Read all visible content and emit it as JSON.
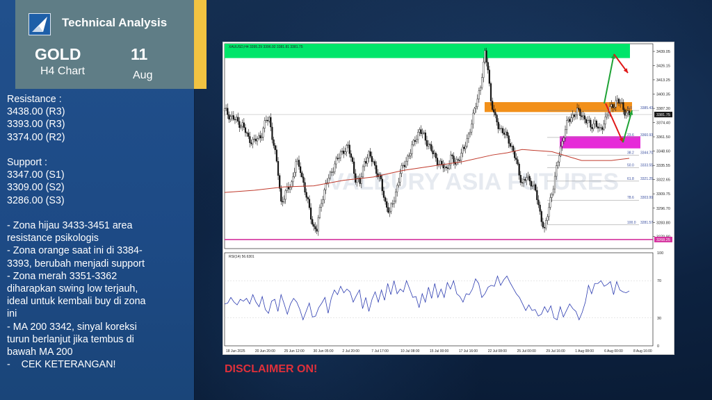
{
  "header": {
    "title": "Technical Analysis",
    "instrument": "GOLD",
    "timeframe": "H4 Chart",
    "day": "11",
    "month": "Aug"
  },
  "notes": [
    "Resistance :",
    "3438.00 (R3)",
    "3393.00 (R3)",
    "3374.00 (R2)",
    "",
    "Support :",
    "3347.00 (S1)",
    "3309.00 (S2)",
    "3286.00 (S3)",
    "",
    "- Zona hijau 3433-3451 area",
    "resistance psikologis",
    "- Zona orange saat ini di 3384-",
    "3393, berubah menjadi support",
    "- Zona merah 3351-3362",
    "diharapkan swing low terjauh,",
    "ideal untuk kembali buy di zona",
    "ini",
    "- MA 200 3342, sinyal koreksi",
    "turun berlanjut jika tembus di",
    "bawah MA 200",
    "-    CEK KETERANGAN!"
  ],
  "disclaimer": "DISCLAIMER ON!",
  "chart_data": {
    "type": "candlestick",
    "symbol_info": "XAUUSD,H4  3395.29 3396.92 3381.81 3381.75",
    "watermark": "VALBURY ASIA FUTURES",
    "price_axis": {
      "ylim": [
        3260,
        3446
      ],
      "ticks": [
        3439.05,
        3426.15,
        3413.25,
        3400.35,
        3387.3,
        3374.4,
        3361.5,
        3348.6,
        3335.55,
        3322.65,
        3309.75,
        3296.7,
        3283.8,
        3270.9
      ],
      "tick_labels": [
        "3439.05",
        "3426.15",
        "3413.25",
        "3400.35",
        "3387.30",
        "3374.40",
        "3361.50",
        "3348.60",
        "3335.55",
        "3322.65",
        "3309.75",
        "3296.70",
        "3283.80",
        "3270.90"
      ],
      "current_price_label": "3381.75",
      "level_label": "3268.25"
    },
    "time_axis": [
      "18 Jun 2025",
      "20 Jun 20:00",
      "25 Jun 12:00",
      "30 Jun 05:00",
      "2 Jul 20:00",
      "7 Jul 17:00",
      "10 Jul 08:00",
      "15 Jul 00:00",
      "17 Jul 16:00",
      "22 Jul 08:00",
      "25 Jul 00:00",
      "29 Jul 16:00",
      "1 Aug 08:00",
      "6 Aug 00:00",
      "8 Aug 16:00"
    ],
    "close_path": [
      [
        0,
        3385
      ],
      [
        6,
        3378
      ],
      [
        12,
        3372
      ],
      [
        16,
        3360
      ],
      [
        20,
        3357
      ],
      [
        24,
        3362
      ],
      [
        28,
        3376
      ],
      [
        30,
        3378
      ],
      [
        33,
        3355
      ],
      [
        36,
        3328
      ],
      [
        38,
        3302
      ],
      [
        41,
        3310
      ],
      [
        45,
        3320
      ],
      [
        48,
        3338
      ],
      [
        51,
        3332
      ],
      [
        54,
        3313
      ],
      [
        57,
        3295
      ],
      [
        60,
        3279
      ],
      [
        62,
        3277
      ],
      [
        65,
        3303
      ],
      [
        68,
        3318
      ],
      [
        71,
        3326
      ],
      [
        74,
        3338
      ],
      [
        77,
        3343
      ],
      [
        80,
        3350
      ],
      [
        83,
        3352
      ],
      [
        86,
        3337
      ],
      [
        88,
        3324
      ],
      [
        91,
        3319
      ],
      [
        94,
        3340
      ],
      [
        97,
        3344
      ],
      [
        100,
        3339
      ],
      [
        103,
        3327
      ],
      [
        105,
        3320
      ],
      [
        108,
        3302
      ],
      [
        111,
        3292
      ],
      [
        114,
        3306
      ],
      [
        118,
        3328
      ],
      [
        122,
        3341
      ],
      [
        125,
        3347
      ],
      [
        128,
        3360
      ],
      [
        131,
        3367
      ],
      [
        134,
        3362
      ],
      [
        137,
        3355
      ],
      [
        140,
        3346
      ],
      [
        143,
        3340
      ],
      [
        146,
        3335
      ],
      [
        149,
        3332
      ],
      [
        152,
        3343
      ],
      [
        155,
        3337
      ],
      [
        158,
        3344
      ],
      [
        161,
        3350
      ],
      [
        164,
        3364
      ],
      [
        167,
        3379
      ],
      [
        170,
        3397
      ],
      [
        172,
        3408
      ],
      [
        175,
        3436
      ],
      [
        177,
        3425
      ],
      [
        179,
        3394
      ],
      [
        182,
        3377
      ],
      [
        185,
        3370
      ],
      [
        188,
        3364
      ],
      [
        191,
        3359
      ],
      [
        194,
        3348
      ],
      [
        197,
        3334
      ],
      [
        200,
        3319
      ],
      [
        203,
        3324
      ],
      [
        206,
        3321
      ],
      [
        209,
        3312
      ],
      [
        211,
        3298
      ],
      [
        213,
        3288
      ],
      [
        215,
        3276
      ],
      [
        217,
        3290
      ],
      [
        219,
        3305
      ],
      [
        222,
        3324
      ],
      [
        225,
        3346
      ],
      [
        228,
        3364
      ],
      [
        231,
        3376
      ],
      [
        234,
        3381
      ],
      [
        237,
        3384
      ],
      [
        240,
        3382
      ],
      [
        243,
        3376
      ],
      [
        246,
        3371
      ],
      [
        249,
        3375
      ],
      [
        252,
        3366
      ],
      [
        255,
        3375
      ],
      [
        258,
        3384
      ],
      [
        261,
        3391
      ],
      [
        264,
        3394
      ],
      [
        267,
        3390
      ],
      [
        270,
        3383
      ],
      [
        272,
        3381
      ]
    ],
    "ma200_path": [
      [
        0,
        3311
      ],
      [
        20,
        3313
      ],
      [
        40,
        3316
      ],
      [
        60,
        3317
      ],
      [
        80,
        3322
      ],
      [
        100,
        3325
      ],
      [
        120,
        3331
      ],
      [
        140,
        3335
      ],
      [
        160,
        3339
      ],
      [
        180,
        3345
      ],
      [
        190,
        3347
      ],
      [
        200,
        3350
      ],
      [
        220,
        3348
      ],
      [
        240,
        3340
      ],
      [
        260,
        3340
      ],
      [
        272,
        3342
      ]
    ],
    "zones": [
      {
        "name": "green",
        "low": 3433,
        "high": 3451,
        "color": "#00e56a"
      },
      {
        "name": "orange",
        "low": 3384,
        "high": 3393,
        "color": "#f2901a"
      },
      {
        "name": "magenta",
        "low": 3351,
        "high": 3362,
        "color": "#e62ad8"
      }
    ],
    "support_line": {
      "value": 3268.25,
      "color": "#d4329e"
    },
    "fibonacci": {
      "levels": [
        "0.0",
        "23.6",
        "38.2",
        "50.0",
        "61.8",
        "78.6",
        "100.0"
      ],
      "prices": [
        "3385.43",
        "3360.93",
        "3344.70",
        "3333.55",
        "3321.25",
        "3303.99",
        "3281.57"
      ]
    },
    "rsi": {
      "label": "RSI(14) 56.6301",
      "ylim": [
        0,
        100
      ],
      "ticks": [
        100,
        70,
        30,
        0
      ],
      "values": [
        45,
        46,
        52,
        47,
        44,
        50,
        48,
        51,
        45,
        55,
        47,
        42,
        53,
        39,
        35,
        48,
        50,
        37,
        55,
        45,
        34,
        45,
        51,
        47,
        39,
        28,
        37,
        46,
        31,
        32,
        41,
        46,
        52,
        35,
        51,
        60,
        55,
        64,
        57,
        61,
        58,
        47,
        54,
        60,
        40,
        52,
        37,
        50,
        58,
        47,
        60,
        49,
        67,
        55,
        70,
        56,
        61,
        58,
        70,
        61,
        52,
        53,
        41,
        56,
        47,
        63,
        51,
        67,
        52,
        61,
        52,
        68,
        61,
        70,
        56,
        53,
        47,
        56,
        55,
        61,
        72,
        67,
        52,
        56,
        63,
        65,
        64,
        75,
        65,
        71,
        75,
        68,
        62,
        56,
        52,
        45,
        38,
        44,
        38,
        39,
        32,
        34,
        42,
        36,
        43,
        30,
        28,
        42,
        31,
        38,
        45,
        40,
        37,
        28,
        36,
        47,
        65,
        56,
        67,
        67,
        70,
        64,
        66,
        69,
        55,
        69,
        60,
        58,
        57,
        59
      ]
    }
  },
  "colors": {
    "panel_blue": "#21508c",
    "header_gray": "#5f7d86",
    "accent_yellow": "#f2c341",
    "disclaimer_red": "#e0303a",
    "ma_red": "#c0392b",
    "arrow_green": "#1fa336",
    "arrow_red": "#e01818"
  }
}
